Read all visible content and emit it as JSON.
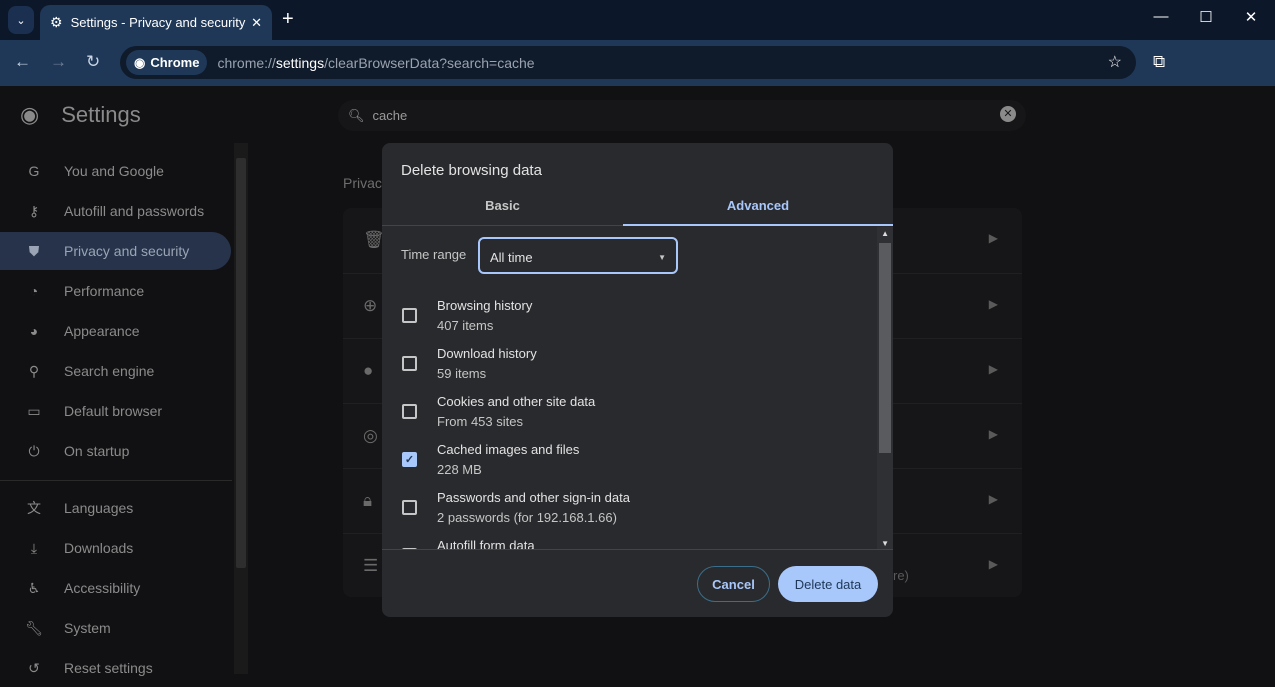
{
  "browser": {
    "tab_title": "Settings - Privacy and security",
    "omnibox_chip": "Chrome",
    "url_prefix": "chrome://",
    "url_host": "settings",
    "url_path": "/clearBrowserData?search=cache"
  },
  "settings": {
    "title": "Settings",
    "search_value": "cache",
    "section_partial": "Privac",
    "card_tail_text": "re)",
    "sidebar": [
      {
        "label": "You and Google",
        "icon": "google-icon"
      },
      {
        "label": "Autofill and passwords",
        "icon": "key-icon"
      },
      {
        "label": "Privacy and security",
        "icon": "shield-icon",
        "selected": true
      },
      {
        "label": "Performance",
        "icon": "speedometer-icon"
      },
      {
        "label": "Appearance",
        "icon": "palette-icon"
      },
      {
        "label": "Search engine",
        "icon": "search-icon"
      },
      {
        "label": "Default browser",
        "icon": "browser-icon"
      },
      {
        "label": "On startup",
        "icon": "power-icon"
      },
      {
        "label": "Languages",
        "icon": "translate-icon"
      },
      {
        "label": "Downloads",
        "icon": "download-icon"
      },
      {
        "label": "Accessibility",
        "icon": "accessibility-icon"
      },
      {
        "label": "System",
        "icon": "wrench-icon"
      },
      {
        "label": "Reset settings",
        "icon": "reset-icon"
      }
    ]
  },
  "dialog": {
    "title": "Delete browsing data",
    "tabs": [
      "Basic",
      "Advanced"
    ],
    "active_tab": "Advanced",
    "time_range_label": "Time range",
    "time_range_value": "All time",
    "options": [
      {
        "title": "Browsing history",
        "sub": "407 items",
        "checked": false
      },
      {
        "title": "Download history",
        "sub": "59 items",
        "checked": false
      },
      {
        "title": "Cookies and other site data",
        "sub": "From 453 sites",
        "checked": false
      },
      {
        "title": "Cached images and files",
        "sub": "228 MB",
        "checked": true
      },
      {
        "title": "Passwords and other sign-in data",
        "sub": "2 passwords (for 192.168.1.66)",
        "checked": false
      },
      {
        "title": "Autofill form data",
        "sub": "",
        "checked": false
      }
    ],
    "cancel_label": "Cancel",
    "delete_label": "Delete data",
    "accent_color": "#a8c7fa"
  }
}
